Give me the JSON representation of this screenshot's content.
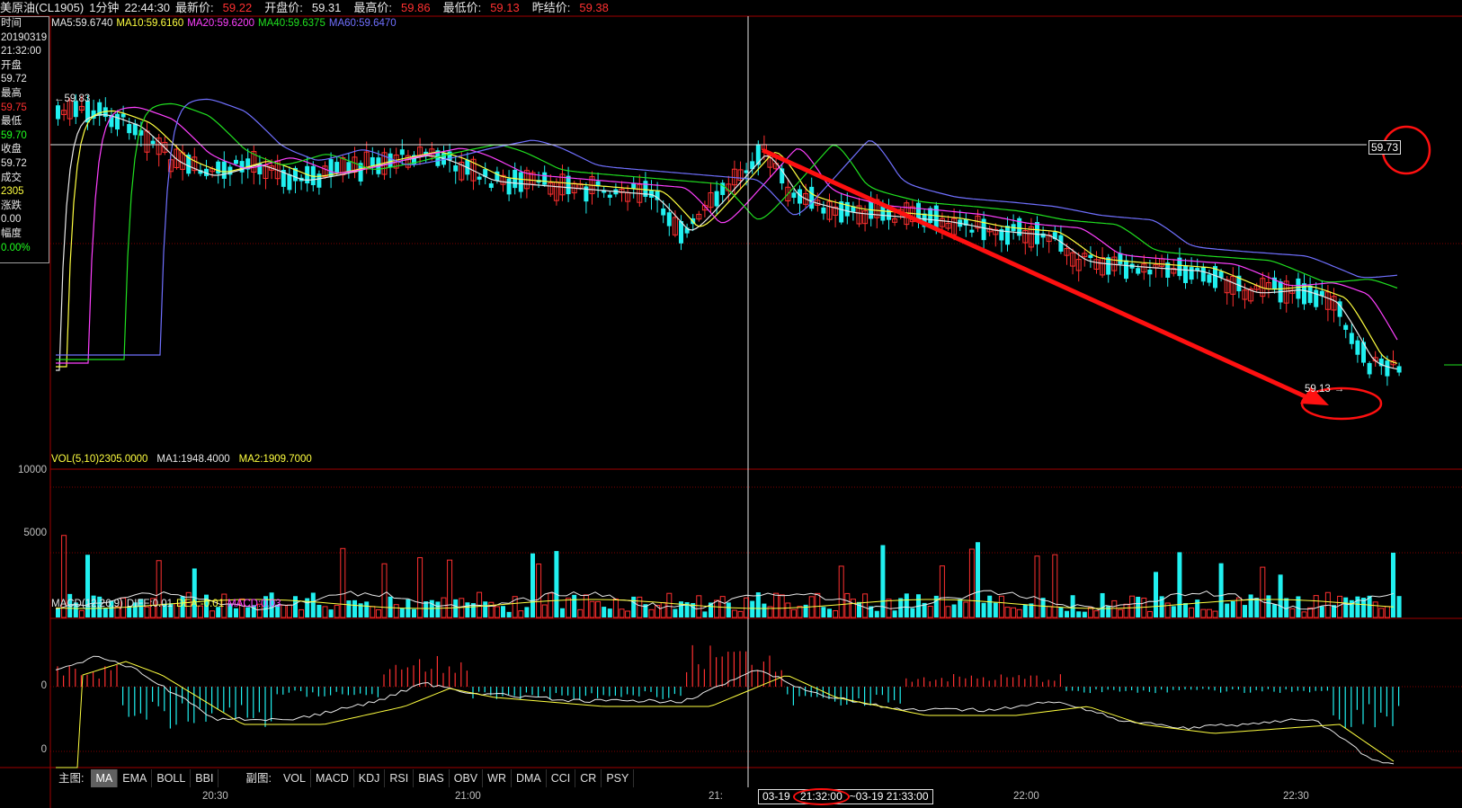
{
  "header": {
    "symbol": "美原油(CL1905)",
    "period": "1分钟",
    "time": "22:44:30",
    "last_label": "最新价:",
    "last_value": "59.22",
    "open_label": "开盘价:",
    "open_value": "59.31",
    "high_label": "最高价:",
    "high_value": "59.86",
    "low_label": "最低价:",
    "low_value": "59.13",
    "prev_label": "昨结价:",
    "prev_value": "59.38"
  },
  "info_panel": {
    "time_label": "时间",
    "date": "20190319",
    "time": "21:32:00",
    "open_label": "开盘",
    "open": "59.72",
    "high_label": "最高",
    "high": "59.75",
    "low_label": "最低",
    "low": "59.70",
    "close_label": "收盘",
    "close": "59.72",
    "volume_label": "成交",
    "volume": "2305",
    "change_label": "涨跌",
    "change": "0.00",
    "amp_label": "幅度",
    "amp": "0.00%"
  },
  "ma_legend": {
    "ma5": "MA5:59.6740",
    "ma10": "MA10:59.6160",
    "ma20": "MA20:59.6200",
    "ma40": "MA40:59.6375",
    "ma60": "MA60:59.6470"
  },
  "colors": {
    "ma5": "#e8e8e8",
    "ma10": "#ffff40",
    "ma20": "#ff40ff",
    "ma40": "#20e020",
    "ma60": "#7070ff",
    "up": "#ff3030",
    "down": "#20f0f0",
    "arrow": "#ff1010"
  },
  "price_marks": {
    "high_mark": "59.83",
    "low_mark": "59.13",
    "cursor_price": "59.73"
  },
  "vol_legend": {
    "vol": "VOL(5,10)2305.0000",
    "ma1": "MA1:1948.4000",
    "ma2": "MA2:1909.7000"
  },
  "vol_axis": [
    "10000",
    "5000"
  ],
  "macd_legend": {
    "macd": "MACD(12,26,9)",
    "diff": "DIFF:0.01",
    "dea": "DEA:-0.01",
    "macd_val": "MACD:0.03"
  },
  "macd_axis": [
    "0",
    "0"
  ],
  "tabs": {
    "main_label": "主图:",
    "main": [
      "MA",
      "EMA",
      "BOLL",
      "BBI"
    ],
    "sub_label": "副图:",
    "sub": [
      "VOL",
      "MACD",
      "KDJ",
      "RSI",
      "BIAS",
      "OBV",
      "WR",
      "DMA",
      "CCI",
      "CR",
      "PSY"
    ]
  },
  "time_axis": {
    "ticks": [
      "20:30",
      "21:00",
      "21:",
      "22:00",
      "22:30"
    ],
    "cursor_start_date": "03-19",
    "cursor_start_time": "21:32:00",
    "cursor_end": "~03-19 21:33:00"
  }
}
